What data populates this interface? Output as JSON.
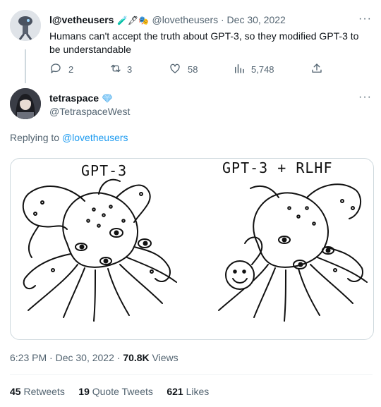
{
  "reply_to_tweet": {
    "display_name": "l@vetheusers",
    "name_emojis": "🧪🖋🎭",
    "handle_date": "@lovetheusers · Dec 30, 2022",
    "text": "Humans can't accept the truth about GPT-3, so they modified GPT-3 to be understandable",
    "metrics": {
      "replies": "2",
      "retweets": "3",
      "likes": "58",
      "views": "5,748"
    },
    "more": "···"
  },
  "main_tweet": {
    "display_name": "tetraspace",
    "handle": "@TetraspaceWest",
    "more": "···",
    "replying_prefix": "Replying to ",
    "replying_handle": "@lovetheusers",
    "image": {
      "left_caption": "GPT-3",
      "right_caption": "GPT-3 + RLHF"
    },
    "timestamp": "6:23 PM · Dec 30, 2022 · ",
    "views_count": "70.8K",
    "views_label": " Views",
    "stats": {
      "retweets_count": "45",
      "retweets_label": " Retweets",
      "quotes_count": "19",
      "quotes_label": " Quote Tweets",
      "likes_count": "621",
      "likes_label": " Likes"
    }
  },
  "colors": {
    "accent": "#1d9bf0",
    "muted": "#536471",
    "verified": "#8ecdf7"
  }
}
